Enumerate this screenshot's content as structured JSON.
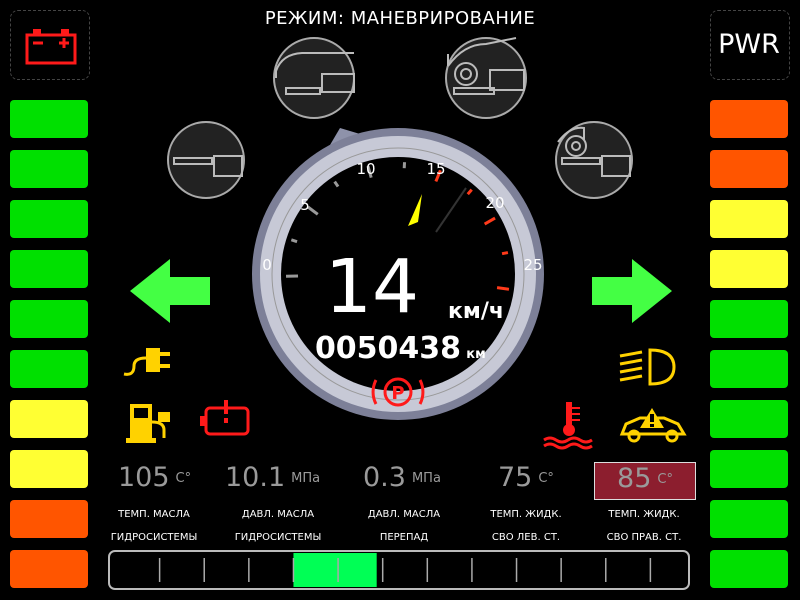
{
  "header": {
    "mode_text": "РЕЖИМ: МАНЕВРИРОВАНИЕ"
  },
  "pwr": {
    "label": "PWR"
  },
  "left_bars": [
    "#00e000",
    "#00e000",
    "#00e000",
    "#00e000",
    "#00e000",
    "#00e000",
    "#ffff33",
    "#ffff33",
    "#ff5500",
    "#ff5500"
  ],
  "right_bars": [
    "#ff5500",
    "#ff5500",
    "#ffff33",
    "#ffff33",
    "#00e000",
    "#00e000",
    "#00e000",
    "#00e000",
    "#00e000",
    "#00e000"
  ],
  "speedometer": {
    "speed": "14",
    "unit": "км/ч",
    "odometer": "0050438",
    "odo_unit": "км",
    "ticks": [
      "0",
      "5",
      "10",
      "15",
      "20",
      "25"
    ],
    "needle_value": 15
  },
  "readouts": [
    {
      "value": "105",
      "unit": "С°",
      "label1": "ТЕМП. МАСЛА",
      "label2": "ГИДРОСИСТЕМЫ",
      "alarm": false
    },
    {
      "value": "10.1",
      "unit": "МПа",
      "label1": "ДАВЛ. МАСЛА",
      "label2": "ГИДРОСИСТЕМЫ",
      "alarm": false
    },
    {
      "value": "0.3",
      "unit": "МПа",
      "label1": "ДАВЛ. МАСЛА",
      "label2": "ПЕРЕПАД",
      "alarm": false
    },
    {
      "value": "75",
      "unit": "С°",
      "label1": "ТЕМП. ЖИДК.",
      "label2": "СВО ЛЕВ. СТ.",
      "alarm": false
    },
    {
      "value": "85",
      "unit": "С°",
      "label1": "ТЕМП. ЖИДК.",
      "label2": "СВО ПРАВ. СТ.",
      "alarm": true
    }
  ],
  "bottom_bar": {
    "segments": 13,
    "active_start": 4,
    "active_end": 6
  },
  "colors": {
    "green": "#00e000",
    "yellow": "#ffff33",
    "orange": "#ff5500",
    "red": "#ff1a1a",
    "amber": "#ffd200",
    "arrow": "#44ff44"
  },
  "icons": [
    "battery-icon",
    "ev-plug-icon",
    "fuel-ev-icon",
    "engine-warning-icon",
    "parking-brake-icon",
    "coolant-temp-icon",
    "headlight-icon",
    "vehicle-warning-icon"
  ]
}
